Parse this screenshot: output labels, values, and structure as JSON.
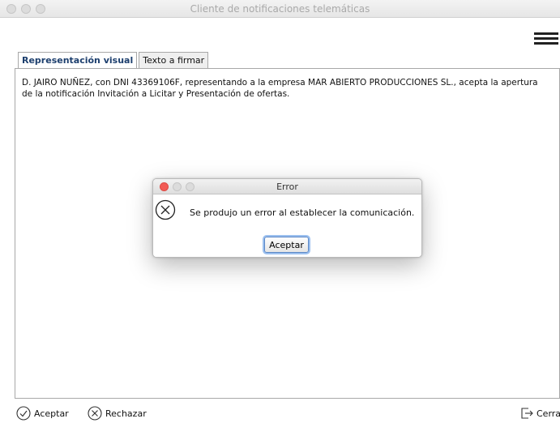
{
  "window": {
    "title": "Cliente de notificaciones telemáticas"
  },
  "menu": {
    "icon": "hamburger-menu-icon"
  },
  "tabs": [
    {
      "label": "Representación visual",
      "active": true
    },
    {
      "label": "Texto a firmar",
      "active": false
    }
  ],
  "content": {
    "text": "D. JAIRO NUÑEZ, con DNI 43369106F, representando a la empresa MAR ABIERTO PRODUCCIONES SL., acepta la apertura de la notificación Invitación a Licitar y Presentación de ofertas."
  },
  "dialog": {
    "title": "Error",
    "icon": "error-circle-x-icon",
    "message": "Se produjo un error al establecer la comunicación.",
    "ok_label": "Aceptar"
  },
  "bottom_bar": {
    "accept_label": "Aceptar",
    "reject_label": "Rechazar",
    "close_label": "Cerrar"
  },
  "colors": {
    "active_tab_text": "#1d3f6e",
    "dialog_close": "#f25b55",
    "focus_ring": "#9cc0ef"
  }
}
